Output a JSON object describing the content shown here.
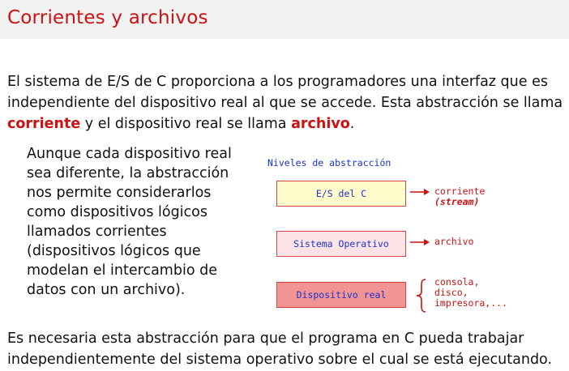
{
  "title": "Corrientes y archivos",
  "intro": {
    "t1": "El sistema de E/S de C proporciona a los programadores una interfaz que es independiente del dispositivo real al que se accede. Esta abstracción se llama ",
    "em1": "corriente",
    "t2": " y el dispositivo real se llama ",
    "em2": "archivo",
    "t3": "."
  },
  "side_text": "Aunque cada dispositivo real sea diferente, la abstracción nos permite considerarlos como dispositivos lógicos llamados corrientes (dispositivos lógicos que modelan el intercambio de datos con un archivo).",
  "diagram": {
    "title": "Niveles de abstracción",
    "levels": [
      "E/S del C",
      "Sistema Operativo",
      "Dispositivo real"
    ],
    "label1": "corriente",
    "label1_sub": "(stream)",
    "label2": "archivo",
    "devices": [
      "consola,",
      "disco,",
      "impresora,..."
    ],
    "colors": {
      "accent": "#cc1111",
      "mono_text": "#1a33cc",
      "box1": "#fffccc",
      "box2": "#fde3e8",
      "box3": "#f29494"
    }
  },
  "closing": "Es necesaria esta abstracción para que el programa en C pueda trabajar independientemente del sistema operativo sobre el cual se está ejecutando."
}
